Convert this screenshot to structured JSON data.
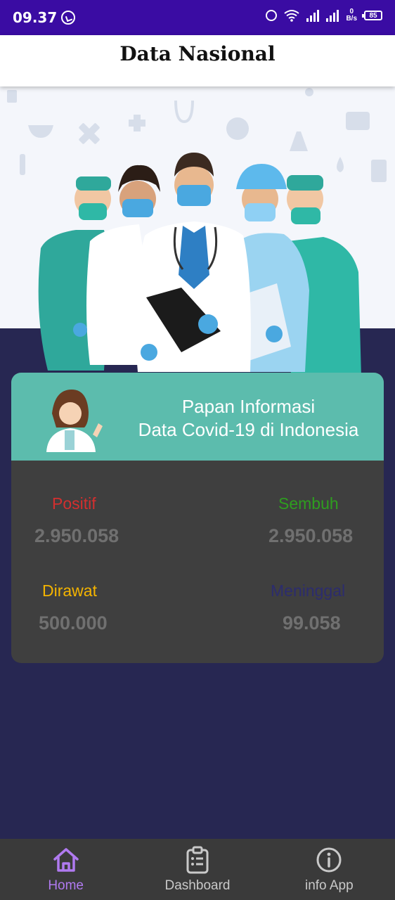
{
  "status_bar": {
    "time": "09.37",
    "net_speed_value": "0",
    "net_speed_unit": "B/s",
    "battery": "85"
  },
  "header": {
    "title": "Data Nasional"
  },
  "card": {
    "title_line1": "Papan Informasi",
    "title_line2": "Data Covid-19 di Indonesia",
    "stats": {
      "positif": {
        "label": "Positif",
        "value": "2.950.058",
        "color": "#d32f2f"
      },
      "sembuh": {
        "label": "Sembuh",
        "value": "2.950.058",
        "color": "#2e9e1f"
      },
      "dirawat": {
        "label": "Dirawat",
        "value": "500.000",
        "color": "#f4b400"
      },
      "meninggal": {
        "label": "Meninggal",
        "value": "99.058",
        "color": "#2c2c6e"
      }
    }
  },
  "bottom_nav": {
    "items": [
      {
        "label": "Home",
        "icon": "home-icon",
        "active": true
      },
      {
        "label": "Dashboard",
        "icon": "clipboard-icon",
        "active": false
      },
      {
        "label": "info App",
        "icon": "info-icon",
        "active": false
      }
    ]
  },
  "colors": {
    "status_bar": "#3a0ca3",
    "background": "#272752",
    "card_header": "#5cbcad",
    "card_body": "#3f3f3f",
    "nav_active": "#b07af0"
  }
}
